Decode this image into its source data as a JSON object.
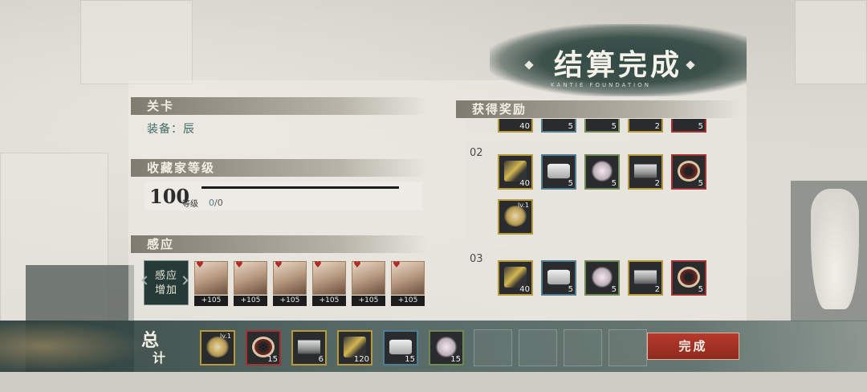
{
  "title": {
    "main": "结算完成",
    "sub": "KANTIE FOUNDATION"
  },
  "stage": {
    "header": "关卡",
    "equipment": "装备：辰"
  },
  "collector": {
    "header": "收藏家等级",
    "level": "100",
    "unit": "等级",
    "exp_current": "0",
    "exp_max": "/0",
    "progress": 1.0
  },
  "induction": {
    "header": "感应",
    "tile_label": "感应增加",
    "heroes": [
      {
        "bonus": "+105"
      },
      {
        "bonus": "+105"
      },
      {
        "bonus": "+105"
      },
      {
        "bonus": "+105"
      },
      {
        "bonus": "+105"
      },
      {
        "bonus": "+105"
      }
    ]
  },
  "rewards": {
    "header": "获得奖励",
    "partial_row": [
      {
        "count": "40",
        "rarity": "gold"
      },
      {
        "count": "5",
        "rarity": "blue"
      },
      {
        "count": "5",
        "rarity": "green"
      },
      {
        "count": "2",
        "rarity": "gold"
      },
      {
        "count": "5",
        "rarity": "red"
      }
    ],
    "rows": [
      {
        "num": "02",
        "items": [
          {
            "count": "40",
            "rarity": "gold",
            "icon": "weapon-icon"
          },
          {
            "count": "5",
            "rarity": "blue",
            "icon": "block-icon"
          },
          {
            "count": "5",
            "rarity": "green",
            "icon": "flower-icon"
          },
          {
            "count": "2",
            "rarity": "gold",
            "icon": "anvil-icon"
          },
          {
            "count": "5",
            "rarity": "red",
            "icon": "wheel-icon"
          },
          {
            "level": "lv.1",
            "rarity": "gold",
            "icon": "medal-icon"
          }
        ]
      },
      {
        "num": "03",
        "items": [
          {
            "count": "40",
            "rarity": "gold",
            "icon": "weapon-icon"
          },
          {
            "count": "5",
            "rarity": "blue",
            "icon": "block-icon"
          },
          {
            "count": "5",
            "rarity": "green",
            "icon": "flower-icon"
          },
          {
            "count": "2",
            "rarity": "gold",
            "icon": "anvil-icon"
          },
          {
            "count": "5",
            "rarity": "red",
            "icon": "wheel-icon"
          }
        ]
      }
    ]
  },
  "total": {
    "label_1": "总",
    "label_2": "计",
    "items": [
      {
        "level": "lv.1",
        "rarity": "gold",
        "icon": "medal-icon"
      },
      {
        "count": "15",
        "rarity": "red",
        "icon": "wheel-icon"
      },
      {
        "count": "6",
        "rarity": "gold",
        "icon": "anvil-icon"
      },
      {
        "count": "120",
        "rarity": "gold",
        "icon": "weapon-icon"
      },
      {
        "count": "15",
        "rarity": "blue",
        "icon": "block-icon"
      },
      {
        "count": "15",
        "rarity": "green",
        "icon": "flower-icon"
      }
    ]
  },
  "done_button": "完成"
}
